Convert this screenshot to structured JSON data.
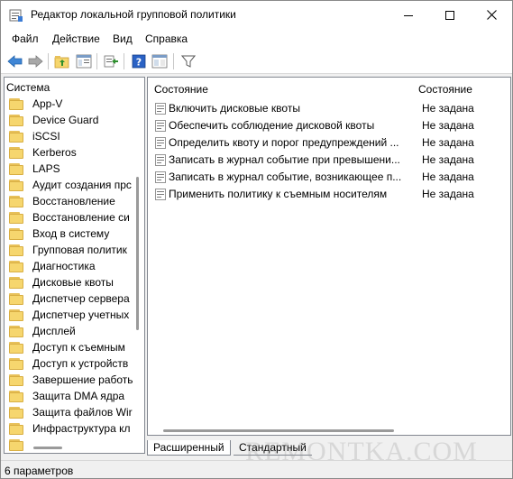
{
  "window": {
    "title": "Редактор локальной групповой политики"
  },
  "menu": [
    "Файл",
    "Действие",
    "Вид",
    "Справка"
  ],
  "toolbar": {
    "buttons": [
      "back-arrow-icon",
      "forward-arrow-icon",
      "up-folder-icon",
      "show-hide-tree-icon",
      "export-list-icon",
      "help-icon",
      "properties-icon",
      "filter-icon"
    ]
  },
  "tree": {
    "root": "Система",
    "items": [
      "App-V",
      "Device Guard",
      "iSCSI",
      "Kerberos",
      "LAPS",
      "Аудит создания прс",
      "Восстановление",
      "Восстановление си",
      "Вход в систему",
      "Групповая политик",
      "Диагностика",
      "Дисковые квоты",
      "Диспетчер сервера",
      "Диспетчер учетных",
      "Дисплей",
      "Доступ к съемным",
      "Доступ к устройств",
      "Завершение работь",
      "Защита DMA ядра",
      "Защита файлов Wir",
      "Инфраструктура кл"
    ]
  },
  "list": {
    "columns": {
      "name": "Состояние",
      "state": "Состояние"
    },
    "rows": [
      {
        "name": "Включить дисковые квоты",
        "state": "Не задана"
      },
      {
        "name": "Обеспечить соблюдение дисковой квоты",
        "state": "Не задана"
      },
      {
        "name": "Определить квоту и порог предупреждений ...",
        "state": "Не задана"
      },
      {
        "name": "Записать в журнал событие при превышени...",
        "state": "Не задана"
      },
      {
        "name": "Записать в журнал событие, возникающее п...",
        "state": "Не задана"
      },
      {
        "name": "Применить политику к съемным носителям",
        "state": "Не задана"
      }
    ]
  },
  "tabs": {
    "extended": "Расширенный",
    "standard": "Стандартный"
  },
  "status": {
    "text": "6 параметров"
  },
  "watermark": "REMONTKA.COM",
  "colors": {
    "folder": "#f6d66e",
    "accent_blue": "#1f6fc5",
    "pane_border": "#828790"
  }
}
